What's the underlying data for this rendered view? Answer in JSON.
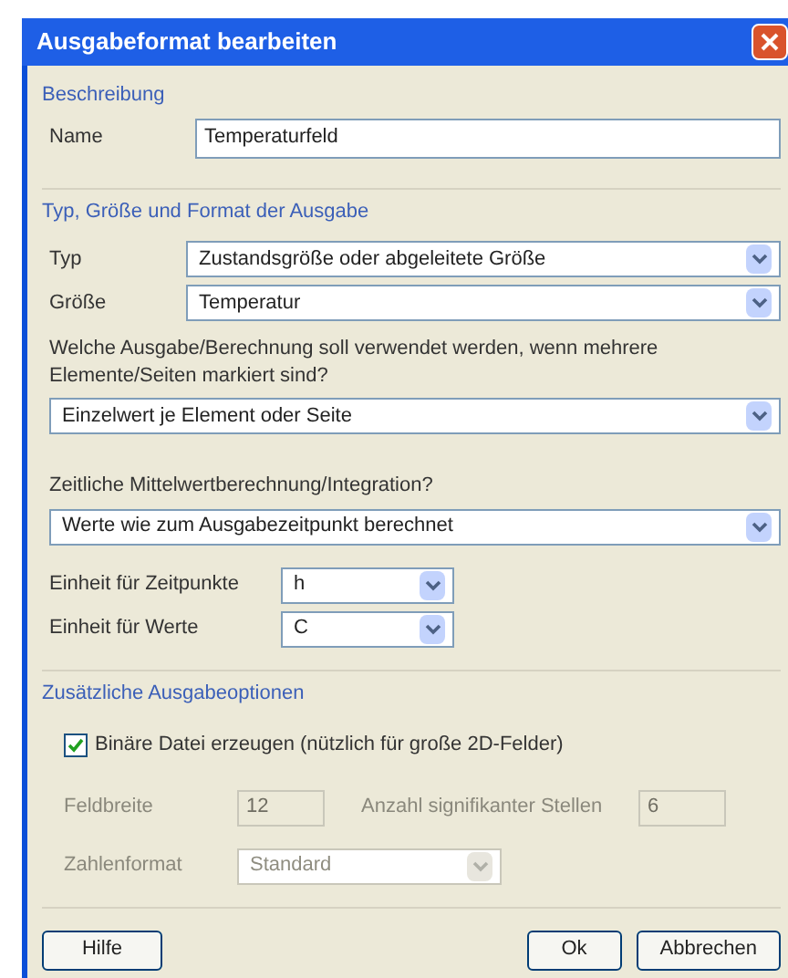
{
  "window": {
    "title": "Ausgabeformat bearbeiten"
  },
  "description": {
    "heading": "Beschreibung",
    "name_label": "Name",
    "name_value": "Temperaturfeld"
  },
  "output": {
    "heading": "Typ, Größe und Format der Ausgabe",
    "type": {
      "label": "Typ",
      "value": "Zustandsgröße oder abgeleitete Größe"
    },
    "quantity": {
      "label": "Größe",
      "value": "Temperatur"
    },
    "question": "Welche Ausgabe/Berechnung soll verwendet werden, wenn mehrere Elemente/Seiten markiert sind?",
    "question_value": "Einzelwert je Element oder Seite",
    "averaging_label": "Zeitliche Mittelwertberechnung/Integration?",
    "averaging_value": "Werte wie zum Ausgabezeitpunkt berechnet",
    "time_unit": {
      "label": "Einheit für Zeitpunkte",
      "value": "h"
    },
    "value_unit": {
      "label": "Einheit für Werte",
      "value": "C"
    }
  },
  "extra": {
    "heading": "Zusätzliche Ausgabeoptionen",
    "binary": {
      "label": "Binäre Datei erzeugen (nützlich für große 2D-Felder)",
      "checked": true
    },
    "field_width": {
      "label": "Feldbreite",
      "value": "12",
      "disabled": true
    },
    "digits": {
      "label": "Anzahl signifikanter Stellen",
      "value": "6",
      "disabled": true
    },
    "number_format": {
      "label": "Zahlenformat",
      "value": "Standard",
      "disabled": true
    }
  },
  "buttons": [
    {
      "label": "Hilfe",
      "kind": "left"
    },
    {
      "label": "Ok",
      "kind": "right"
    },
    {
      "label": "Abbrechen",
      "kind": "right"
    }
  ]
}
